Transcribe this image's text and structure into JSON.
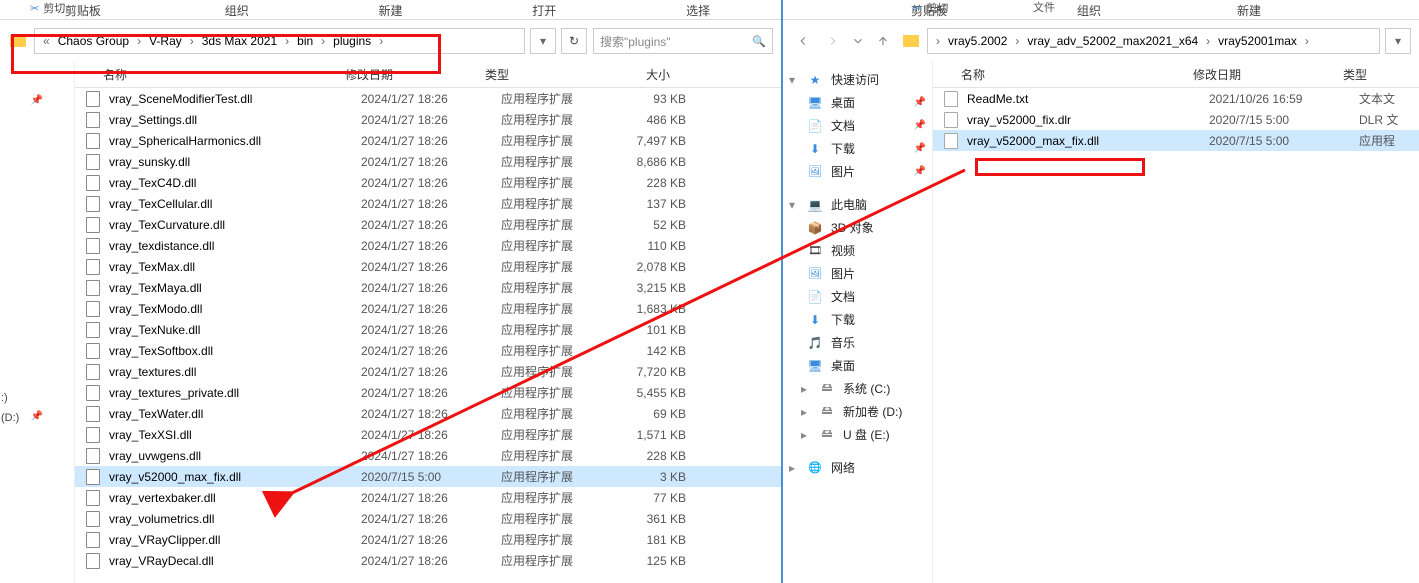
{
  "left": {
    "ribbon": {
      "cut": "剪切",
      "clipboard": "剪贴板",
      "organize": "组织",
      "new": "新建",
      "open": "打开",
      "select": "选择"
    },
    "breadcrumb": [
      "Chaos Group",
      "V-Ray",
      "3ds Max 2021",
      "bin",
      "plugins"
    ],
    "search_placeholder": "搜索\"plugins\"",
    "columns": {
      "name": "名称",
      "date": "修改日期",
      "type": "类型",
      "size": "大小"
    },
    "type_label": "应用程序扩展",
    "files": [
      {
        "name": "vray_SceneModifierTest.dll",
        "date": "2024/1/27 18:26",
        "size": "93 KB"
      },
      {
        "name": "vray_Settings.dll",
        "date": "2024/1/27 18:26",
        "size": "486 KB"
      },
      {
        "name": "vray_SphericalHarmonics.dll",
        "date": "2024/1/27 18:26",
        "size": "7,497 KB"
      },
      {
        "name": "vray_sunsky.dll",
        "date": "2024/1/27 18:26",
        "size": "8,686 KB"
      },
      {
        "name": "vray_TexC4D.dll",
        "date": "2024/1/27 18:26",
        "size": "228 KB"
      },
      {
        "name": "vray_TexCellular.dll",
        "date": "2024/1/27 18:26",
        "size": "137 KB"
      },
      {
        "name": "vray_TexCurvature.dll",
        "date": "2024/1/27 18:26",
        "size": "52 KB"
      },
      {
        "name": "vray_texdistance.dll",
        "date": "2024/1/27 18:26",
        "size": "110 KB"
      },
      {
        "name": "vray_TexMax.dll",
        "date": "2024/1/27 18:26",
        "size": "2,078 KB"
      },
      {
        "name": "vray_TexMaya.dll",
        "date": "2024/1/27 18:26",
        "size": "3,215 KB"
      },
      {
        "name": "vray_TexModo.dll",
        "date": "2024/1/27 18:26",
        "size": "1,683 KB"
      },
      {
        "name": "vray_TexNuke.dll",
        "date": "2024/1/27 18:26",
        "size": "101 KB"
      },
      {
        "name": "vray_TexSoftbox.dll",
        "date": "2024/1/27 18:26",
        "size": "142 KB"
      },
      {
        "name": "vray_textures.dll",
        "date": "2024/1/27 18:26",
        "size": "7,720 KB"
      },
      {
        "name": "vray_textures_private.dll",
        "date": "2024/1/27 18:26",
        "size": "5,455 KB"
      },
      {
        "name": "vray_TexWater.dll",
        "date": "2024/1/27 18:26",
        "size": "69 KB"
      },
      {
        "name": "vray_TexXSI.dll",
        "date": "2024/1/27 18:26",
        "size": "1,571 KB"
      },
      {
        "name": "vray_uvwgens.dll",
        "date": "2024/1/27 18:26",
        "size": "228 KB"
      },
      {
        "name": "vray_v52000_max_fix.dll",
        "date": "2020/7/15 5:00",
        "size": "3 KB",
        "selected": true
      },
      {
        "name": "vray_vertexbaker.dll",
        "date": "2024/1/27 18:26",
        "size": "77 KB"
      },
      {
        "name": "vray_volumetrics.dll",
        "date": "2024/1/27 18:26",
        "size": "361 KB"
      },
      {
        "name": "vray_VRayClipper.dll",
        "date": "2024/1/27 18:26",
        "size": "181 KB"
      },
      {
        "name": "vray_VRayDecal.dll",
        "date": "2024/1/27 18:26",
        "size": "125 KB"
      }
    ],
    "drives": {
      "c_label": ":)",
      "d_label": "(D:)"
    }
  },
  "right": {
    "ribbon": {
      "cut": "剪切",
      "clipboard": "剪贴板",
      "organize": "组织",
      "filehint": "文件",
      "new": "新建"
    },
    "breadcrumb": [
      "vray5.2002",
      "vray_adv_52002_max2021_x64",
      "vray52001max"
    ],
    "columns": {
      "name": "名称",
      "date": "修改日期",
      "type": "类型"
    },
    "quick_access": "快速访问",
    "items": {
      "desktop": "桌面",
      "documents": "文档",
      "downloads": "下载",
      "pictures": "图片",
      "this_pc": "此电脑",
      "objects3d": "3D 对象",
      "videos": "视频",
      "music": "音乐",
      "sys_c": "系统 (C:)",
      "vol_d": "新加卷 (D:)",
      "u_e": "U 盘 (E:)",
      "network": "网络"
    },
    "files": [
      {
        "name": "ReadMe.txt",
        "date": "2021/10/26 16:59",
        "type": "文本文"
      },
      {
        "name": "vray_v52000_fix.dlr",
        "date": "2020/7/15 5:00",
        "type": "DLR 文"
      },
      {
        "name": "vray_v52000_max_fix.dll",
        "date": "2020/7/15 5:00",
        "type": "应用程",
        "selected": true
      }
    ]
  }
}
